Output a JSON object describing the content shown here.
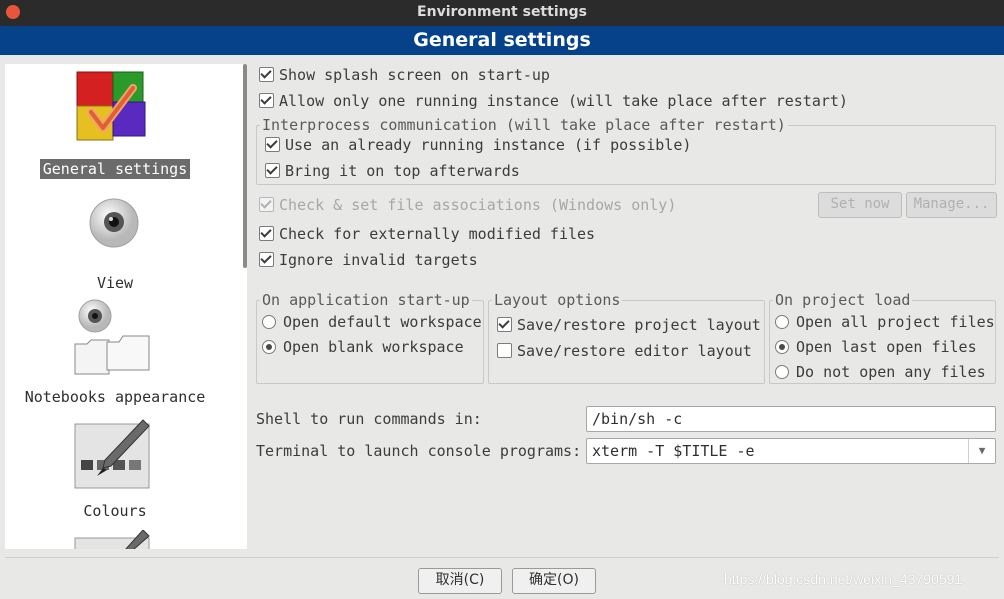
{
  "window": {
    "title": "Environment settings"
  },
  "header": {
    "title": "General settings"
  },
  "sidebar": {
    "items": [
      {
        "label": "General settings",
        "icon": "settings-cubes-icon",
        "selected": true
      },
      {
        "label": "View",
        "icon": "eye-icon",
        "selected": false
      },
      {
        "label": "Notebooks appearance",
        "icon": "notebooks-icon",
        "selected": false
      },
      {
        "label": "Colours",
        "icon": "palette-icon",
        "selected": false
      }
    ]
  },
  "options": {
    "splash": {
      "label": "Show splash screen on start-up",
      "checked": true
    },
    "single_instance": {
      "label": "Allow only one running instance (will take place after restart)",
      "checked": true
    },
    "ipc": {
      "title": "Interprocess communication (will take place after restart)",
      "use_running": {
        "label": "Use an already running instance (if possible)",
        "checked": true
      },
      "bring_top": {
        "label": "Bring it on top afterwards",
        "checked": true
      }
    },
    "file_assoc": {
      "label": "Check & set file associations (Windows only)",
      "checked": true,
      "enabled": false
    },
    "set_now": "Set now",
    "manage": "Manage...",
    "modified": {
      "label": "Check for externally modified files",
      "checked": true
    },
    "ignore_invalid": {
      "label": "Ignore invalid targets",
      "checked": true
    }
  },
  "startup": {
    "title": "On application start-up",
    "options": [
      "Open default workspace",
      "Open blank workspace"
    ],
    "selected": 1
  },
  "layout": {
    "title": "Layout options",
    "project": {
      "label": "Save/restore project layout",
      "checked": true
    },
    "editor": {
      "label": "Save/restore editor layout",
      "checked": false
    }
  },
  "project_load": {
    "title": "On project load",
    "options": [
      "Open all project files",
      "Open last open files",
      "Do not open any files"
    ],
    "selected": 1
  },
  "shell": {
    "label": "Shell to run commands in:",
    "value": "/bin/sh -c"
  },
  "terminal": {
    "label": "Terminal to launch console programs:",
    "value": "xterm -T $TITLE -e"
  },
  "footer": {
    "cancel": "取消(C)",
    "ok": "确定(O)"
  },
  "watermark": "https://blog.csdn.net/weixin_43790591",
  "colors": {
    "header_bg": "#06428a",
    "titlebar_bg": "#2b2b2b",
    "close": "#e8553a"
  }
}
